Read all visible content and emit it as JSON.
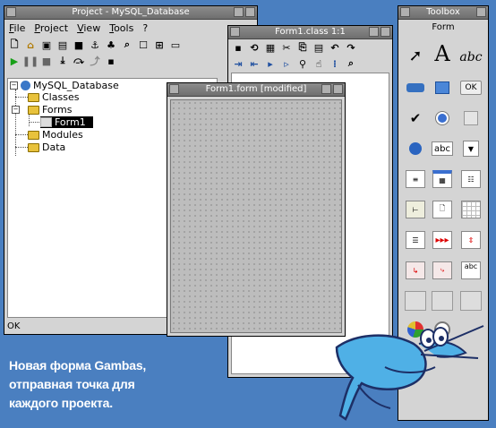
{
  "project_window": {
    "title": "Project - MySQL_Database",
    "menu": [
      "File",
      "Project",
      "View",
      "Tools",
      "?"
    ],
    "tree": {
      "root": "MySQL_Database",
      "items": [
        "Classes",
        "Forms",
        "Form1",
        "Modules",
        "Data"
      ]
    },
    "status": "OK"
  },
  "class_window": {
    "title": "Form1.class 1:1"
  },
  "form_window": {
    "title": "Form1.form [modified]"
  },
  "toolbox": {
    "title": "Toolbox",
    "section": "Form",
    "text_tools": {
      "label_glyph": "A",
      "textlabel": "abc",
      "button": "OK",
      "combo": "abc",
      "textarea": "abc"
    }
  },
  "caption": {
    "line1": "Новая форма Gambas,",
    "line2": "отправная точка для",
    "line3": "каждого проекта."
  },
  "colors": {
    "desktop": "#4a7fc0",
    "window": "#d4d4d4",
    "titlebar": "#7a7a7a",
    "selection": "#000000",
    "mascot": "#4fb0e6"
  }
}
